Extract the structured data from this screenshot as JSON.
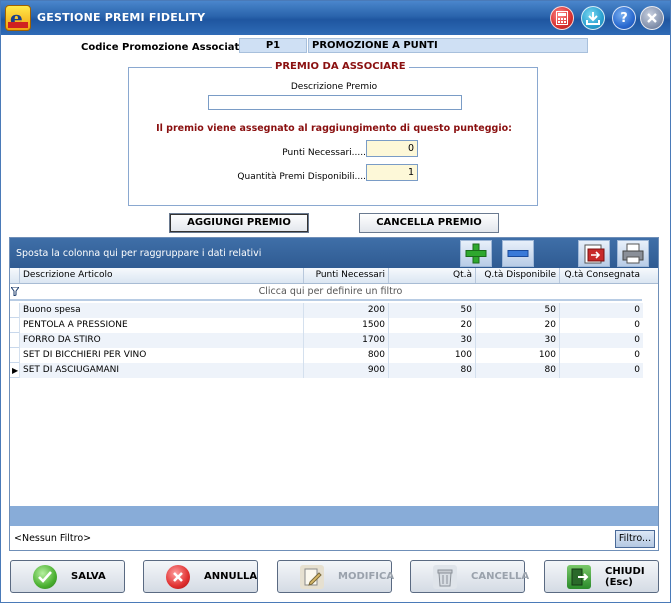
{
  "window": {
    "title": "GESTIONE PREMI FIDELITY",
    "title_buttons": [
      "calculator-icon",
      "download-icon",
      "help-icon",
      "close-icon"
    ]
  },
  "promotion": {
    "label": "Codice Promozione Associata.....",
    "code": "P1",
    "description": "PROMOZIONE A PUNTI"
  },
  "prize": {
    "legend": "PREMIO DA ASSOCIARE",
    "description_label": "Descrizione Premio",
    "description_value": "",
    "assign_text": "Il premio viene assegnato al raggiungimento di questo punteggio:",
    "points_label": "Punti Necessari.....",
    "points_value": "0",
    "qty_label": "Quantità Premi Disponibili....",
    "qty_value": "1"
  },
  "actions": {
    "add": "AGGIUNGI PREMIO",
    "delete": "CANCELLA PREMIO"
  },
  "grid": {
    "group_hint": "Sposta la colonna qui per raggruppare i dati relativi",
    "columns": [
      "Descrizione Articolo",
      "Punti Necessari",
      "Qt.à",
      "Q.tà Disponibile",
      "Q.tà Consegnata"
    ],
    "filter_hint": "Clicca qui per definire un filtro",
    "rows": [
      {
        "desc": "Buono spesa",
        "points": "200",
        "qty": "50",
        "available": "50",
        "delivered": "0"
      },
      {
        "desc": "PENTOLA A PRESSIONE",
        "points": "1500",
        "qty": "20",
        "available": "20",
        "delivered": "0"
      },
      {
        "desc": "FORRO DA STIRO",
        "points": "1700",
        "qty": "30",
        "available": "30",
        "delivered": "0"
      },
      {
        "desc": "SET DI BICCHIERI PER VINO",
        "points": "800",
        "qty": "100",
        "available": "100",
        "delivered": "0"
      },
      {
        "desc": "SET DI ASCIUGAMANI",
        "points": "900",
        "qty": "80",
        "available": "80",
        "delivered": "0"
      }
    ],
    "no_filter": "<Nessun Filtro>",
    "filter_button": "Filtro..."
  },
  "bottom": {
    "save": "SALVA",
    "cancel": "ANNULLA",
    "edit": "MODIFICA",
    "delete": "CANCELLA",
    "close": "CHIUDI (Esc)"
  },
  "colors": {
    "title_bar": "#2a64ac",
    "group_bar": "#3f6fa8",
    "accent_red": "#8a1010",
    "input_yellow": "#fdf8d8"
  }
}
